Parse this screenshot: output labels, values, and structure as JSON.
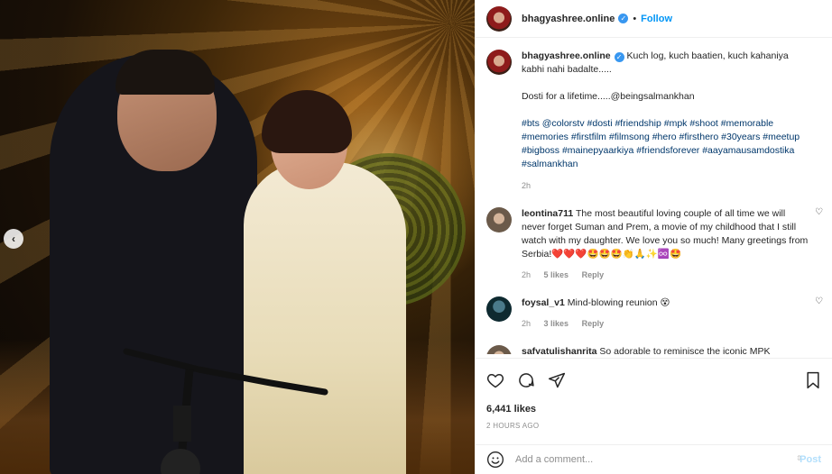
{
  "post": {
    "username": "bhagyashree.online",
    "follow_label": "Follow",
    "separator": "•",
    "caption_line1": "Kuch log, kuch baatien, kuch kahaniya kabhi nahi badalte.....",
    "caption_line2": "Dosti for a lifetime.....@beingsalmankhan",
    "hashtags": "#bts @colorstv #dosti #friendship #mpk #shoot #memorable #memories #firstfilm #filmsong #hero #firsthero #30years #meetup #bigboss #mainepyaarkiya #friendsforever #aayamausamdostika #salmankhan",
    "caption_time": "2h",
    "likes": "6,441 likes",
    "posted_ago": "2 HOURS AGO"
  },
  "comments": [
    {
      "username": "leontina711",
      "text": "The most beautiful loving couple of all time we will never forget Suman and Prem, a movie of my childhood that I still watch with my daughter. We love you so much! Many greetings from Serbia!❤️❤️❤️🤩🤩🤩👏🙏✨♾️🤩",
      "time": "2h",
      "likes": "5 likes",
      "reply": "Reply"
    },
    {
      "username": "foysal_v1",
      "text": "Mind-blowing reunion 😵",
      "time": "2h",
      "likes": "3 likes",
      "reply": "Reply"
    },
    {
      "username": "safyatulishanrita",
      "text": "So adorable to reminisce the iconic MPK",
      "time": "",
      "likes": "",
      "reply": ""
    }
  ],
  "add_comment": {
    "placeholder": "Add a comment...",
    "post_label": "Post"
  },
  "media": {
    "carousel_arrow": "‹"
  },
  "colors": {
    "link": "#00376b",
    "follow": "#0095f6",
    "verified": "#3897f0",
    "post_disabled": "#b2dffc"
  }
}
